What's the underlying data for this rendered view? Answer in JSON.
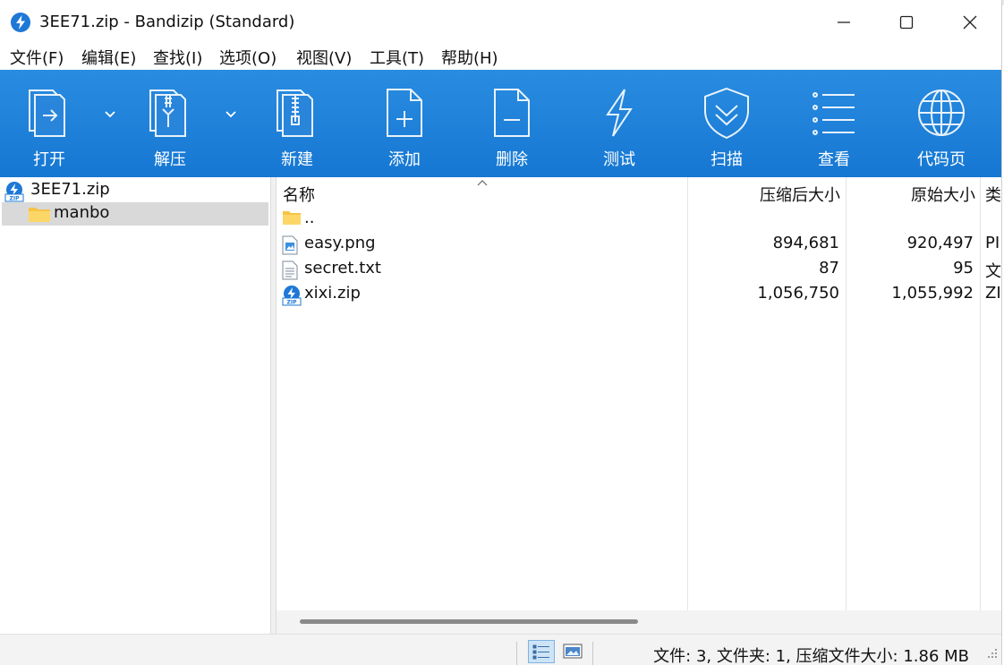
{
  "window": {
    "title": "3EE71.zip - Bandizip (Standard)"
  },
  "menu": [
    {
      "label": "文件(F)"
    },
    {
      "label": "编辑(E)"
    },
    {
      "label": "查找(I)"
    },
    {
      "label": "选项(O)"
    },
    {
      "label": "视图(V)"
    },
    {
      "label": "工具(T)"
    },
    {
      "label": "帮助(H)"
    }
  ],
  "toolbar": {
    "open": "打开",
    "extract": "解压",
    "new": "新建",
    "add": "添加",
    "delete": "删除",
    "test": "测试",
    "scan": "扫描",
    "view": "查看",
    "codepage": "代码页"
  },
  "tree": {
    "root": "3EE71.zip",
    "folder": "manbo"
  },
  "columns": {
    "name": "名称",
    "compressed": "压缩后大小",
    "original": "原始大小",
    "type": "类"
  },
  "files": [
    {
      "name": "..",
      "compressed": "",
      "original": "",
      "type": "",
      "icon": "folder-icon"
    },
    {
      "name": "easy.png",
      "compressed": "894,681",
      "original": "920,497",
      "type": "PI",
      "icon": "image-file-icon"
    },
    {
      "name": "secret.txt",
      "compressed": "87",
      "original": "95",
      "type": "文",
      "icon": "text-file-icon"
    },
    {
      "name": "xixi.zip",
      "compressed": "1,056,750",
      "original": "1,055,992",
      "type": "ZI",
      "icon": "zip-file-icon"
    }
  ],
  "status": {
    "summary": "文件: 3, 文件夹: 1, 压缩文件大小: 1.86 MB"
  },
  "colors": {
    "toolbar": "#1a7fd8",
    "accent": "#1e78d6"
  }
}
